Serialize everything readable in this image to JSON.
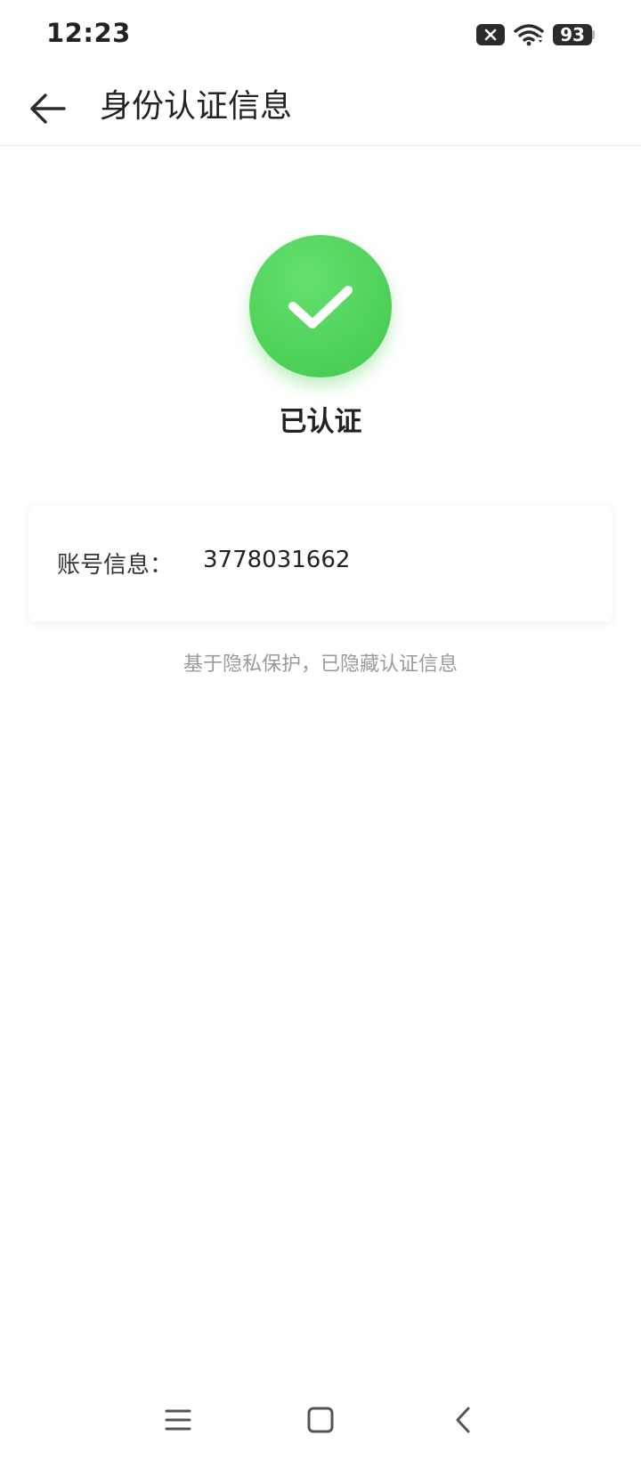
{
  "status_bar": {
    "time": "12:23",
    "battery": "93",
    "icons": [
      "sim-error-icon",
      "wifi-icon",
      "battery-icon"
    ]
  },
  "header": {
    "title": "身份认证信息",
    "back_icon": "arrow-left-icon"
  },
  "verification": {
    "status": "已认证",
    "icon": "check-circle-icon",
    "color": "#4fd25a"
  },
  "account_card": {
    "label": "账号信息：",
    "value": "3778031662"
  },
  "privacy_note": "基于隐私保护，已隐藏认证信息",
  "nav_bar": {
    "buttons": [
      "menu-icon",
      "home-icon",
      "back-icon"
    ]
  }
}
